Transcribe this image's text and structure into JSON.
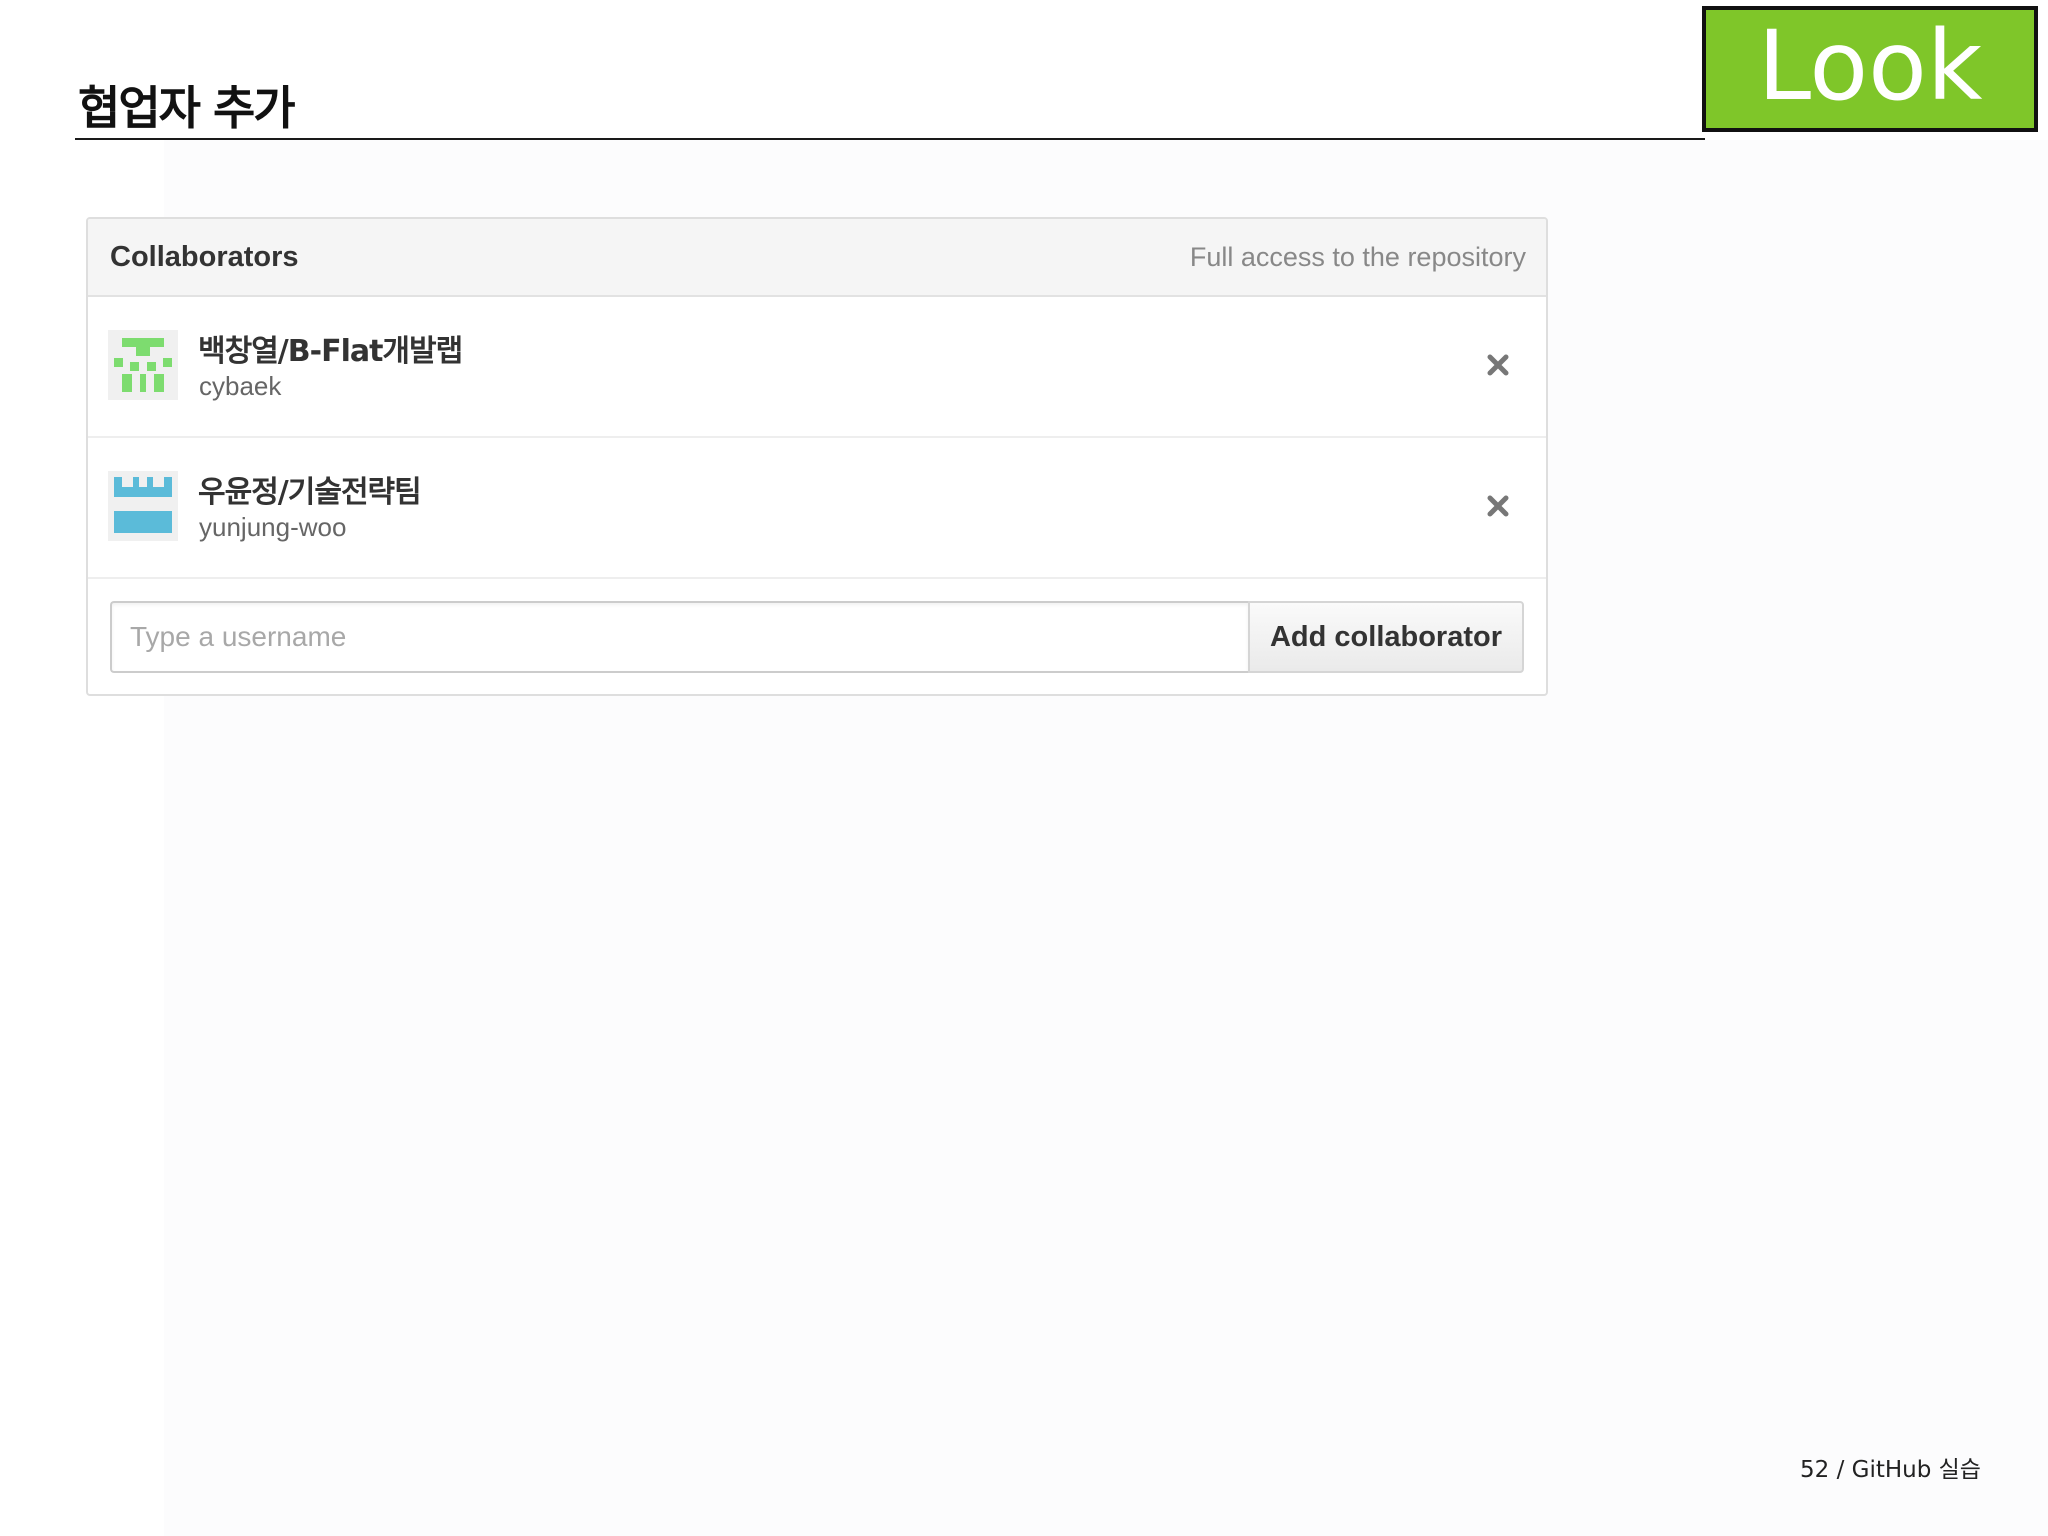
{
  "slide": {
    "title": "협업자 추가",
    "badge": "Look",
    "footer": "52 / GitHub 실습"
  },
  "panel": {
    "title": "Collaborators",
    "subtitle": "Full access to the repository"
  },
  "collaborators": [
    {
      "name": "백창열/B-Flat개발랩",
      "login": "cybaek",
      "avatar_color": "#7ddc6f",
      "remove_icon": "close-icon"
    },
    {
      "name": "우윤정/기술전략팀",
      "login": "yunjung-woo",
      "avatar_color": "#5bbbd9",
      "remove_icon": "close-icon"
    }
  ],
  "add_form": {
    "placeholder": "Type a username",
    "value": "",
    "button_label": "Add collaborator"
  },
  "colors": {
    "badge_green": "#7fc629",
    "panel_header_bg": "#f5f5f5"
  }
}
